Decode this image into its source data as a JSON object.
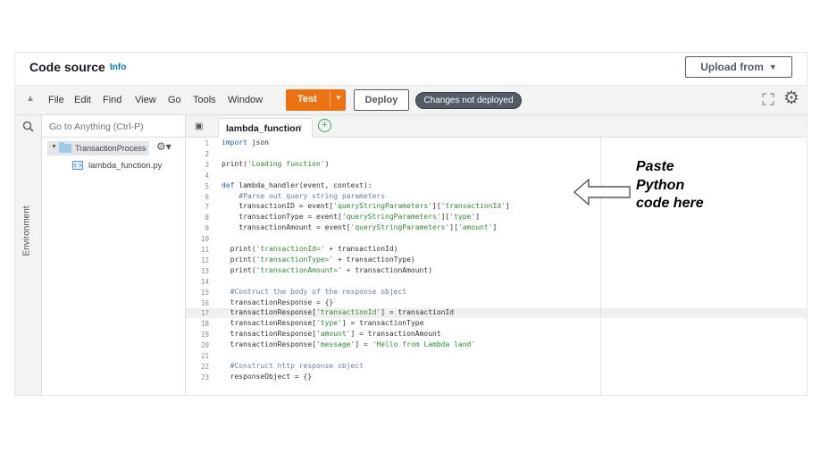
{
  "header": {
    "title": "Code source",
    "info_link": "Info",
    "upload_button": "Upload from"
  },
  "toolbar": {
    "menu": [
      "File",
      "Edit",
      "Find",
      "View",
      "Go",
      "Tools",
      "Window"
    ],
    "test_button": "Test",
    "deploy_button": "Deploy",
    "status": "Changes not deployed"
  },
  "sidebar": {
    "search_placeholder": "Go to Anything (Ctrl-P)",
    "environment_tab": "Environment"
  },
  "file_tree": {
    "folder": "TransactionProcessor",
    "file": "lambda_function.py"
  },
  "editor": {
    "tab_name": "lambda_function",
    "highlight_line": 17,
    "lines": [
      "import json",
      "",
      "print('Loading function')",
      "",
      "def lambda_handler(event, context):",
      "    #Parse out query string parameters",
      "    transactionID = event['queryStringParameters']['transactionId']",
      "    transactionType = event['queryStringParameters']['type']",
      "    transactionAmount = event['queryStringParameters']['amount']",
      "",
      "  print('transactionId=' + transactionId)",
      "  print('transactionType=' + transactionType)",
      "  print('transactionAmount=' + transactionAmount)",
      "",
      "  #Contruct the body of the response object",
      "  transactionResponse = {}",
      "  transactionResponse['transactionId'] = transactionId",
      "  transactionResponse['type'] = transactionType",
      "  transactionResponse['amount'] = transactionAmount",
      "  transactionResponse['message'] = 'Hello from Lambda land'",
      "",
      "  #Construct http response object",
      "  responseObject = {}"
    ]
  },
  "annotation": {
    "lines": [
      "Paste",
      "Python",
      "code here"
    ]
  },
  "colors": {
    "accent": "#ec7211",
    "status_pill": "#545b64",
    "link": "#0073bb"
  }
}
